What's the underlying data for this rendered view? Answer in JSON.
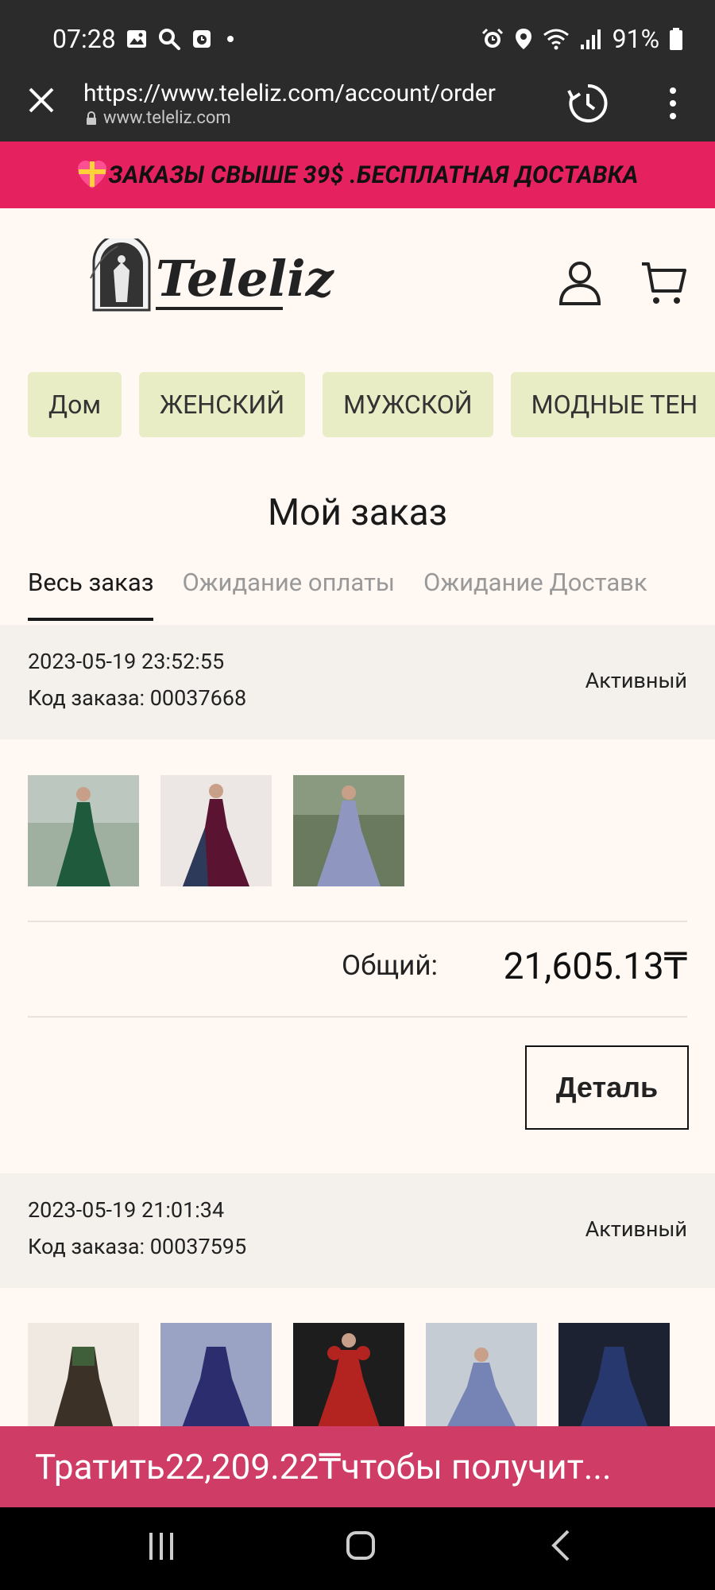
{
  "status_bar": {
    "time": "07:28",
    "battery": "91%",
    "icons": [
      "image-icon",
      "search-icon",
      "calendar-icon",
      "dot-icon",
      "alarm-icon",
      "location-icon",
      "wifi-icon",
      "signal-icon",
      "battery-icon"
    ]
  },
  "browser": {
    "url": "https://www.teleliz.com/account/order",
    "host": "www.teleliz.com"
  },
  "promo_banner": {
    "text": "ЗАКАЗЫ СВЫШЕ 39$ .БЕСПЛАТНАЯ ДОСТАВКА"
  },
  "header": {
    "logo_text": "Teleliz"
  },
  "nav": {
    "items": [
      {
        "label": "Дом"
      },
      {
        "label": "ЖЕНСКИЙ"
      },
      {
        "label": "МУЖСКОЙ"
      },
      {
        "label": "МОДНЫЕ ТЕН"
      }
    ]
  },
  "page": {
    "title": "Мой заказ",
    "tabs": [
      {
        "label": "Весь заказ",
        "active": true
      },
      {
        "label": "Ожидание оплаты",
        "active": false
      },
      {
        "label": "Ожидание Доставк",
        "active": false
      }
    ]
  },
  "orders": [
    {
      "date": "2023-05-19 23:52:55",
      "code": "Код заказа: 00037668",
      "status": "Активный",
      "total_label": "Общий:",
      "total_value": "21,605.13₸",
      "detail_label": "Деталь",
      "thumb_colors": [
        "#1f5a3c",
        "#5a1432",
        "#8f96c0"
      ]
    },
    {
      "date": "2023-05-19 21:01:34",
      "code": "Код заказа: 00037595",
      "status": "Активный",
      "thumb_colors": [
        "#3b3127",
        "#2c2d6e",
        "#b3231f",
        "#7583b5",
        "#27386e"
      ]
    }
  ],
  "bottom_promo": {
    "text": "Тратить22,209.22₸чтобы получит..."
  },
  "colors": {
    "promo": "#e6215f",
    "nav_button": "#e8edc5",
    "bottom_promo": "#cf3c65",
    "page_bg": "#fff8f3"
  }
}
